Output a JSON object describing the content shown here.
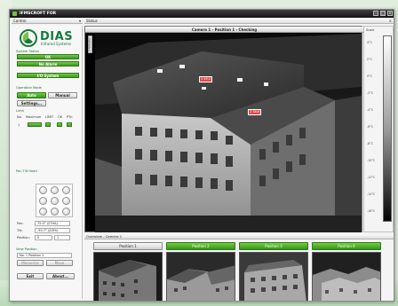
{
  "window": {
    "title": "IFMSCROFT FOR"
  },
  "window_controls": [
    "–",
    "□",
    "×"
  ],
  "left_header": "Control",
  "status_header": "Status",
  "logo": {
    "name": "DIAS",
    "subtitle": "Infrared Systems"
  },
  "system_status": {
    "label": "System Status",
    "ok": "OK",
    "alarm": "No Alarm",
    "io": "I/O System"
  },
  "operation_mode": {
    "label": "Operation Mode",
    "auto": "Auto",
    "manual": "Manual",
    "settings": "Settings..."
  },
  "limit": {
    "label": "Limit",
    "columns": [
      "No.",
      "Maximum",
      "LIMIT",
      "OK",
      "PTn"
    ],
    "row_no": "1"
  },
  "pan_tilt": {
    "label": "Pan Tilt Head"
  },
  "fields": {
    "pan_label": "Pan:",
    "pan_value": "75.0° (27HA)",
    "tilt_label": "Tilt:",
    "tilt_value": "-50.7° (A3Fh)",
    "position_label": "Position:",
    "position_value": "0",
    "position_value_2": "1"
  },
  "view_position": {
    "label": "View Position",
    "selector": "No. 1 Position 1",
    "memorize": "Memorize",
    "move": "Move"
  },
  "actions": {
    "exit": "Exit",
    "about": "About..."
  },
  "video": {
    "caption": "Camera 1 - Position 1 - Checking",
    "cam_tab": "Camera 1"
  },
  "temp_markers": [
    "1 45.2",
    "2 38.6"
  ],
  "scale": {
    "label": "Scale",
    "ticks": [
      "4°C",
      "2°C",
      "0°C",
      "-2°C",
      "-4°C",
      "-6°C",
      "-8°C",
      "-10°C",
      "-12°C",
      "-14°C",
      "-16°C"
    ]
  },
  "overview": {
    "label": "Overview - Camera 1",
    "positions": [
      "Position 1",
      "Position 2",
      "Position 3",
      "Position 4"
    ]
  },
  "colors": {
    "accent_green": "#4aa82a",
    "brand_green": "#157a3b",
    "alarm_marker": "#e04848"
  }
}
